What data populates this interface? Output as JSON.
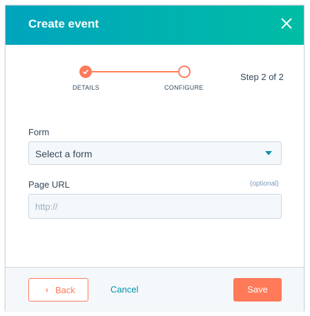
{
  "dialog": {
    "title": "Create event",
    "close_icon": "close-icon"
  },
  "stepper": {
    "steps": [
      {
        "label": "DETAILS",
        "state": "complete",
        "icon": "checkmark-icon"
      },
      {
        "label": "CONFIGURE",
        "state": "current"
      }
    ],
    "counter": "Step 2 of 2"
  },
  "form": {
    "form_field": {
      "label": "Form",
      "value": "Select a form",
      "icon": "caret-down-icon"
    },
    "page_url": {
      "label": "Page URL",
      "optional": "(optional)",
      "placeholder": "http://"
    }
  },
  "footer": {
    "back": "Back",
    "back_icon": "chevron-left-icon",
    "cancel": "Cancel",
    "save": "Save"
  },
  "colors": {
    "header_start": "#00a4bd",
    "header_end": "#00bda5",
    "accent": "#ff7a59",
    "link": "#0091ae",
    "text": "#33475b"
  }
}
